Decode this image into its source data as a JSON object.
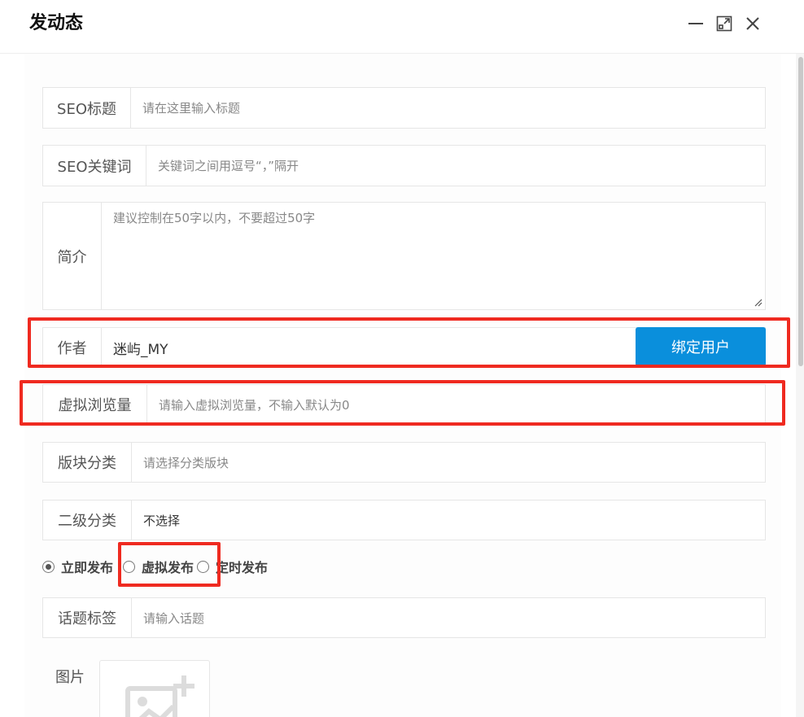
{
  "dialog": {
    "title": "发动态",
    "minimize_icon": "minimize-icon",
    "maximize_icon": "maximize-icon",
    "close_icon": "close-icon"
  },
  "form": {
    "seo_title": {
      "label": "SEO标题",
      "placeholder": "请在这里输入标题"
    },
    "seo_keywords": {
      "label": "SEO关键词",
      "placeholder": "关键词之间用逗号“，”隔开"
    },
    "summary": {
      "label": "简介",
      "placeholder": "建议控制在50字以内，不要超过50字"
    },
    "author": {
      "label": "作者",
      "value": "迷屿_MY",
      "bind_button": "绑定用户"
    },
    "virtual_views": {
      "label": "虚拟浏览量",
      "placeholder": "请输入虚拟浏览量，不输入默认为0"
    },
    "block_category": {
      "label": "版块分类",
      "placeholder": "请选择分类版块"
    },
    "sub_category": {
      "label": "二级分类",
      "value": "不选择"
    },
    "publish_options": [
      {
        "label": "立即发布",
        "selected": true
      },
      {
        "label": "虚拟发布",
        "selected": false
      },
      {
        "label": "定时发布",
        "selected": false
      }
    ],
    "topic_tags": {
      "label": "话题标签",
      "placeholder": "请输入话题"
    },
    "images": {
      "label": "图片",
      "upload_icon": "add-image-icon"
    }
  },
  "colors": {
    "primary_button": "#0a8fdc",
    "highlight": "#ef2a20"
  }
}
